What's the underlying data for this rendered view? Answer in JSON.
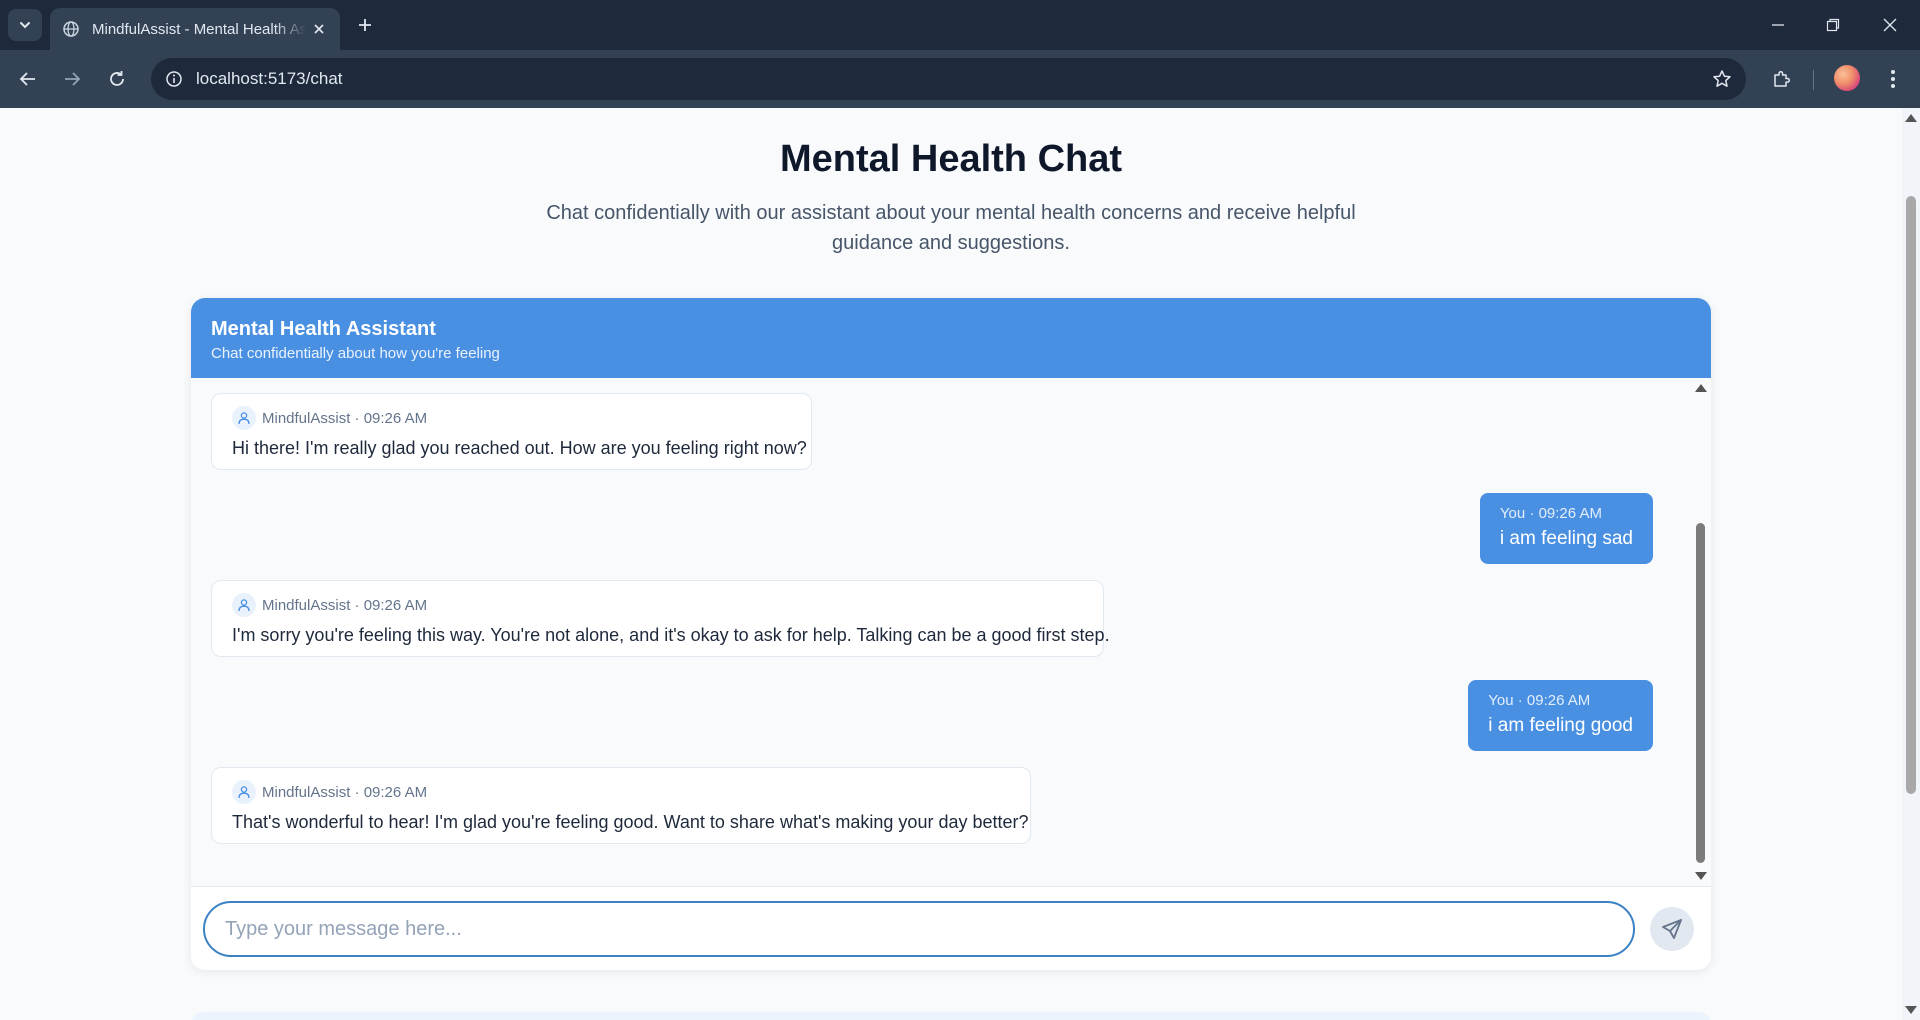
{
  "browser": {
    "tab_title": "MindfulAssist - Mental Health Assistant",
    "url": "localhost:5173/chat"
  },
  "page": {
    "title": "Mental Health Chat",
    "subtitle": "Chat confidentially with our assistant about your mental health concerns and receive helpful guidance and suggestions."
  },
  "chat": {
    "header_title": "Mental Health Assistant",
    "header_subtitle": "Chat confidentially about how you're feeling",
    "messages": [
      {
        "role": "assistant",
        "meta": "MindfulAssist · 09:26 AM",
        "text": "Hi there! I'm really glad you reached out. How are you feeling right now?"
      },
      {
        "role": "user",
        "meta": "You · 09:26 AM",
        "text": "i am feeling sad"
      },
      {
        "role": "assistant",
        "meta": "MindfulAssist · 09:26 AM",
        "text": "I'm sorry you're feeling this way. You're not alone, and it's okay to ask for help. Talking can be a good first step."
      },
      {
        "role": "user",
        "meta": "You · 09:26 AM",
        "text": "i am feeling good"
      },
      {
        "role": "assistant",
        "meta": "MindfulAssist · 09:26 AM",
        "text": "That's wonderful to hear! I'm glad you're feeling good. Want to share what's making your day better?"
      }
    ],
    "input": {
      "placeholder": "Type your message here...",
      "value": ""
    }
  },
  "icons": {
    "tab_list": "chevron-down-icon",
    "tab_favicon": "globe-icon",
    "tab_close": "close-icon",
    "new_tab": "plus-icon",
    "minimize": "minimize-icon",
    "restore": "restore-icon",
    "close_window": "close-icon",
    "back": "arrow-left-icon",
    "forward": "arrow-right-icon",
    "reload": "reload-icon",
    "site_info": "info-icon",
    "bookmark": "star-icon",
    "extensions": "puzzle-icon",
    "profile": "avatar",
    "menu": "kebab-menu-icon",
    "assistant_avatar": "user-icon",
    "send": "send-icon"
  },
  "colors": {
    "accent": "#4a90e2",
    "chrome_dark": "#1e293b",
    "chrome_toolbar": "#334155",
    "page_bg": "#f8fafc",
    "user_bubble": "#4a90e2",
    "bot_bubble": "#ffffff"
  }
}
